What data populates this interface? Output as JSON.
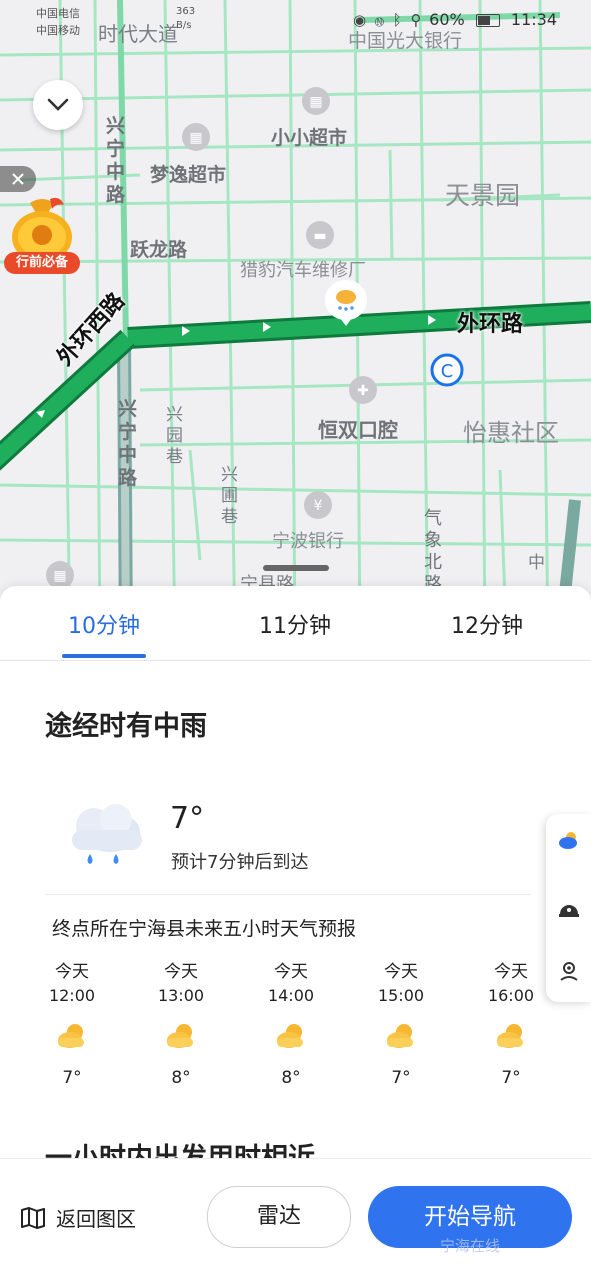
{
  "status_bar": {
    "carrier1": "中国电信",
    "carrier2": "中国移动",
    "speed": "363",
    "speed_unit": "B/s",
    "battery": "60%",
    "time": "11:34"
  },
  "map": {
    "labels": {
      "shidai": "时代大道",
      "guangda": "中国光大银行",
      "xingning_zhong_1": "兴宁中路",
      "xiaoxiao": "小小超市",
      "mengyi": "梦逸超市",
      "tianjing": "天景园",
      "yuelong": "跃龙路",
      "liebao": "猎豹汽车维修厂",
      "waihuan_h": "外环路",
      "waihuan_w": "外环西路",
      "xingning_zhong_2": "兴宁中路",
      "xingyuan_xiang_1": "兴园巷",
      "xingyuan_xiang_2": "兴圃巷",
      "hengshuang": "恒双口腔",
      "yihui": "怡惠社区",
      "ningbo_bank": "宁波银行",
      "qixiang": "气象北路",
      "ning": "宁县路",
      "zhong": "中"
    },
    "promo_label": "行前必备"
  },
  "tabs": [
    {
      "label": "10分钟",
      "active": true
    },
    {
      "label": "11分钟",
      "active": false
    },
    {
      "label": "12分钟",
      "active": false
    }
  ],
  "headline": "途经时有中雨",
  "current": {
    "temp": "7°",
    "arrival": "预计7分钟后到达"
  },
  "forecast_title": "终点所在宁海县未来五小时天气预报",
  "forecast": [
    {
      "day": "今天",
      "time": "12:00",
      "temp": "7°",
      "icon": "partly-cloudy-icon"
    },
    {
      "day": "今天",
      "time": "13:00",
      "temp": "8°",
      "icon": "partly-cloudy-icon"
    },
    {
      "day": "今天",
      "time": "14:00",
      "temp": "8°",
      "icon": "partly-cloudy-icon"
    },
    {
      "day": "今天",
      "time": "15:00",
      "temp": "7°",
      "icon": "partly-cloudy-icon"
    },
    {
      "day": "今天",
      "time": "16:00",
      "temp": "7°",
      "icon": "partly-cloudy-icon"
    }
  ],
  "partial_heading": "一小时内出发用时相近",
  "bottom": {
    "back_label": "返回图区",
    "radar_label": "雷达",
    "nav_label": "开始导航"
  },
  "colors": {
    "accent": "#2f73ef",
    "route": "#1aa053",
    "road": "#8fe0b0"
  },
  "watermark": "宁海在线"
}
